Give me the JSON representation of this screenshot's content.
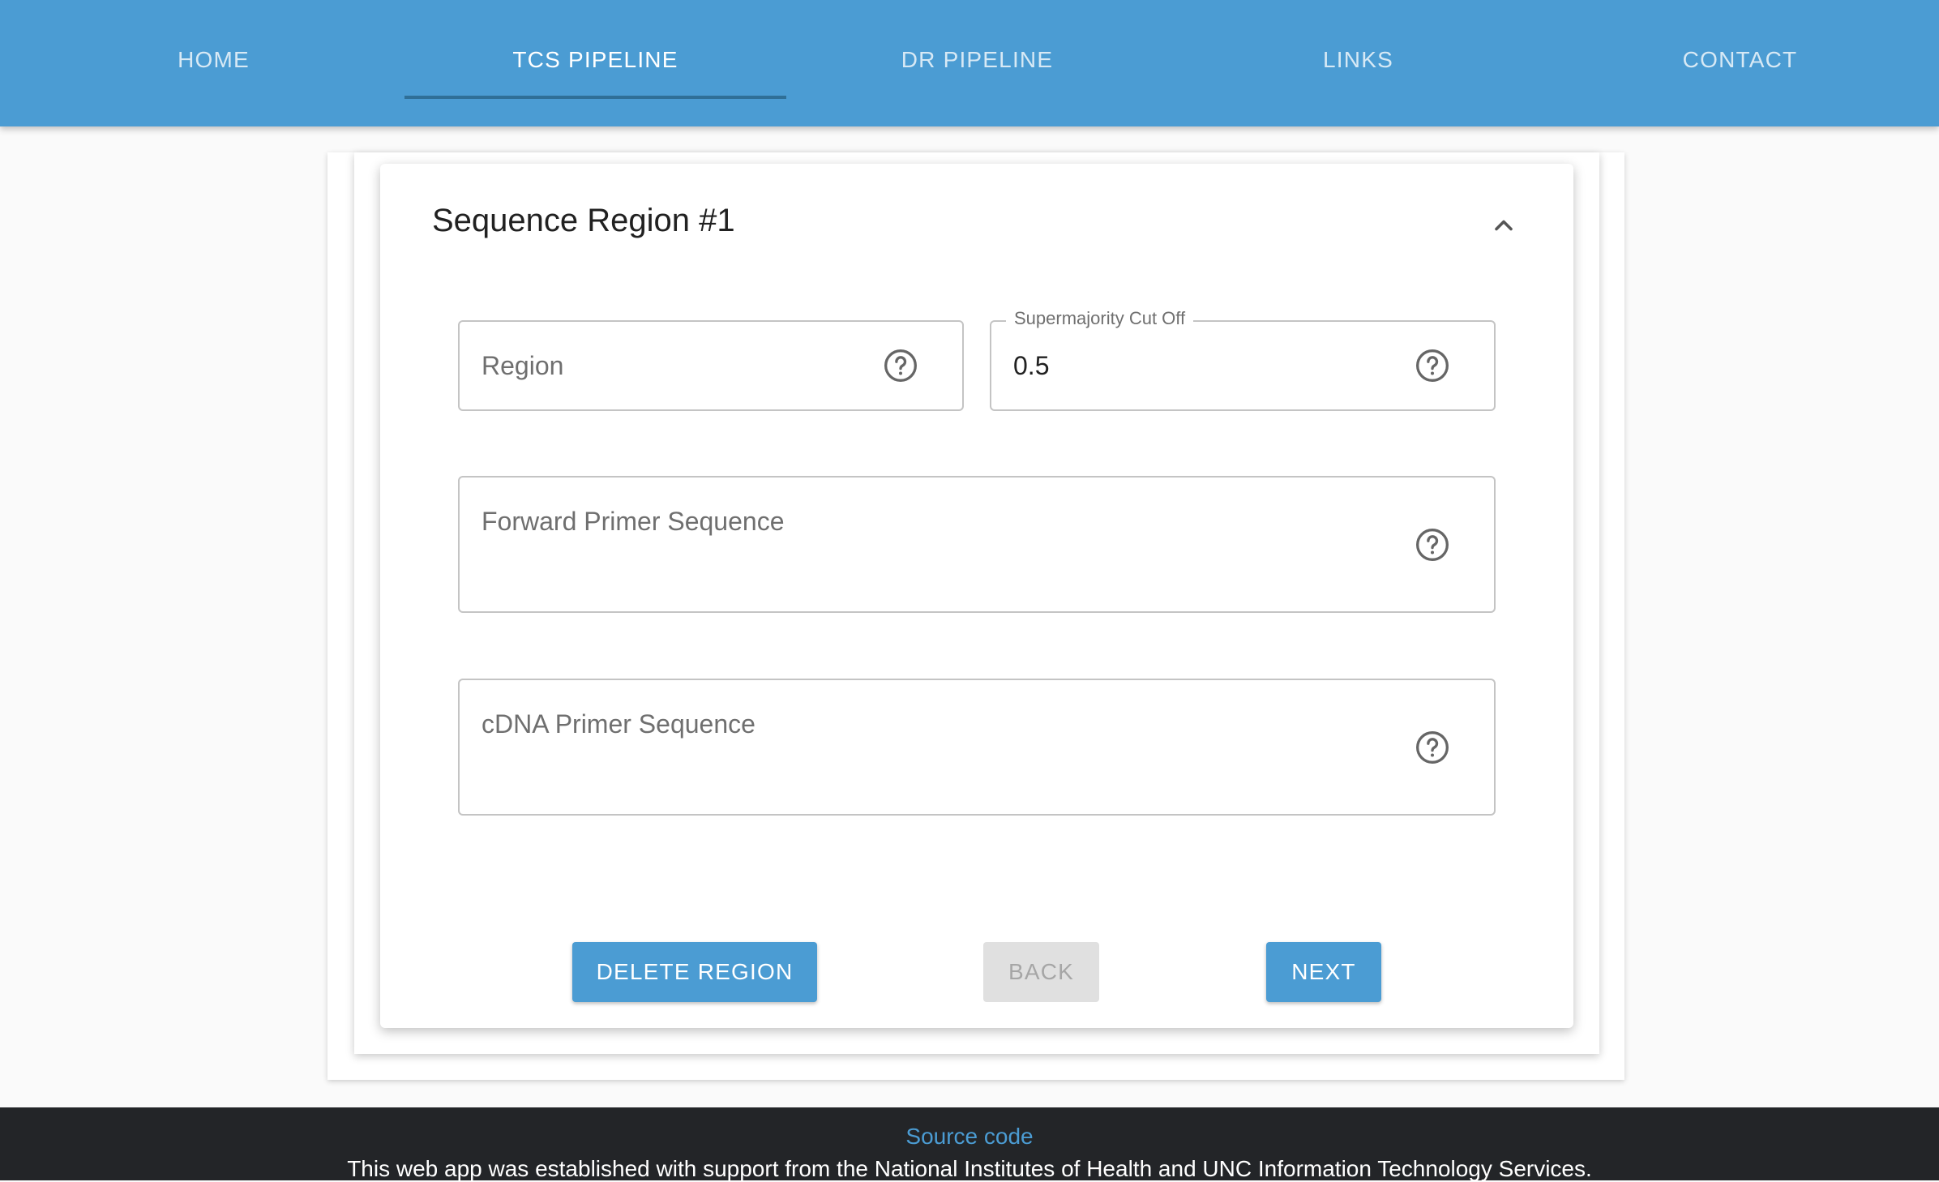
{
  "nav": {
    "tabs": [
      {
        "label": "HOME"
      },
      {
        "label": "TCS PIPELINE",
        "active": true
      },
      {
        "label": "DR PIPELINE"
      },
      {
        "label": "LINKS"
      },
      {
        "label": "CONTACT"
      }
    ]
  },
  "region": {
    "title": "Sequence Region #1",
    "collapse_icon": "chevron-up-icon",
    "fields": {
      "region": {
        "label": "Region",
        "value": ""
      },
      "supermajority": {
        "label": "Supermajority Cut Off",
        "value": "0.5"
      },
      "forward_primer": {
        "label": "Forward Primer Sequence",
        "value": ""
      },
      "cdna_primer": {
        "label": "cDNA Primer Sequence",
        "value": ""
      }
    },
    "help_icon": "help-circle-icon",
    "buttons": {
      "delete": "DELETE REGION",
      "back": "BACK",
      "next": "NEXT"
    }
  },
  "footer": {
    "source_link": "Source code",
    "support_text": "This web app was established with support from the National Institutes of Health and UNC Information Technology Services."
  },
  "colors": {
    "primary": "#4b9cd3",
    "footer_bg": "#232528",
    "disabled_bg": "#e0e0e0"
  }
}
